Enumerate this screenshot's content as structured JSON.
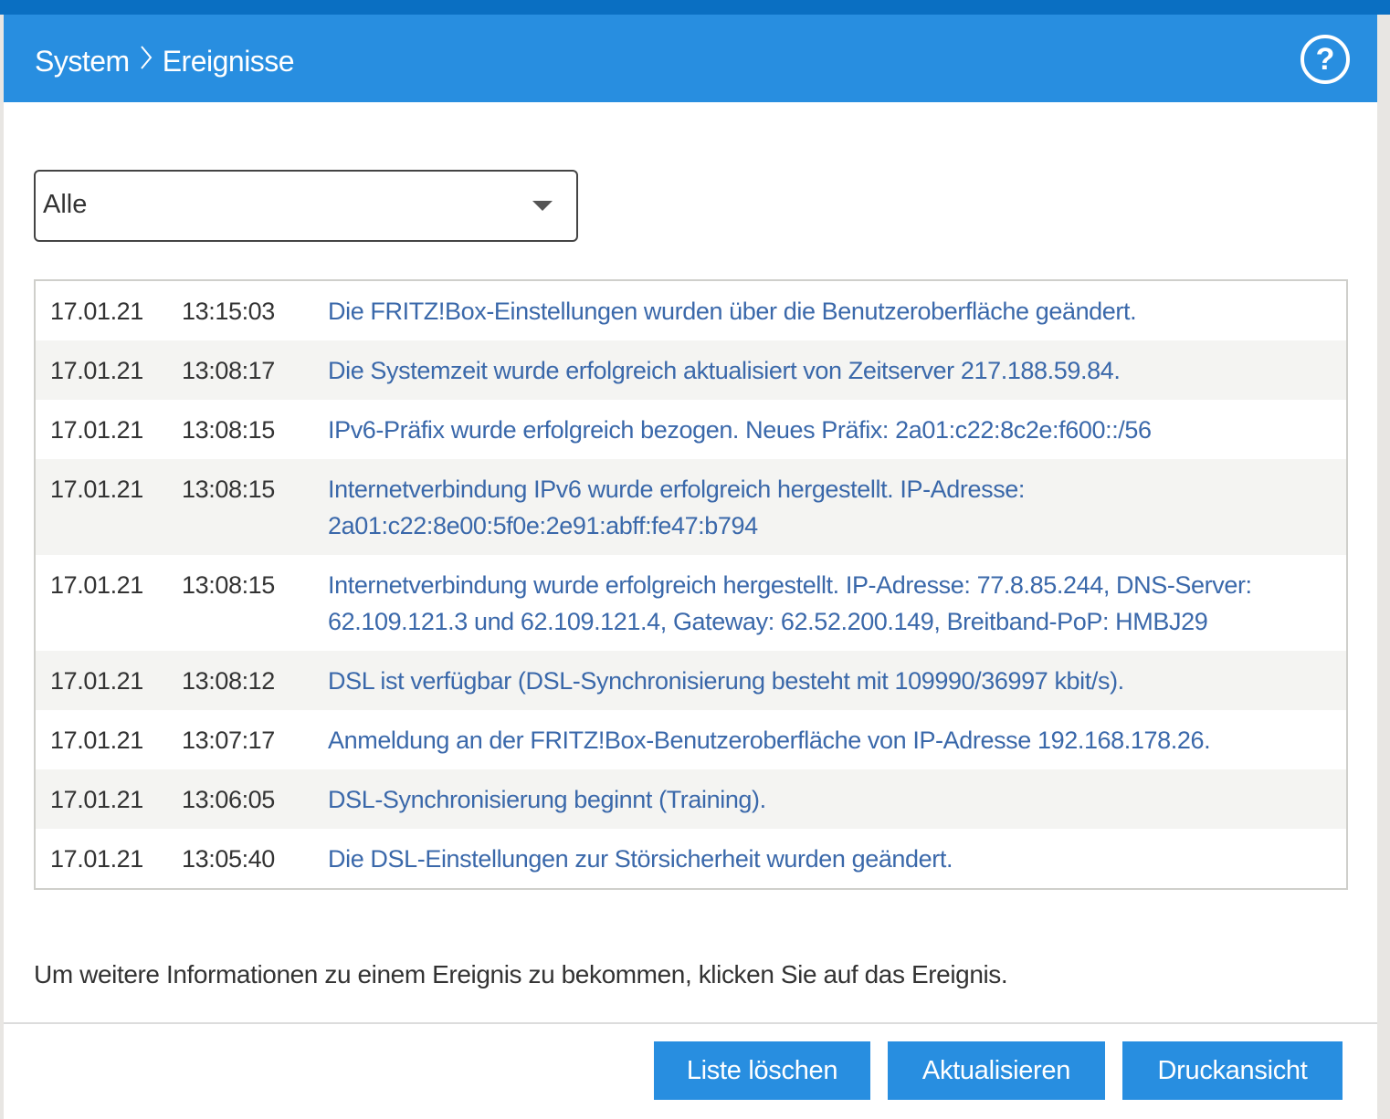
{
  "header": {
    "crumb_parent": "System",
    "crumb_separator": "›",
    "crumb_current": "Ereignisse",
    "help_label": "?"
  },
  "filter": {
    "selected": "Alle"
  },
  "events": [
    {
      "date": "17.01.21",
      "time": "13:15:03",
      "message": "Die FRITZ!Box-Einstellungen wurden über die Benutzeroberfläche geändert."
    },
    {
      "date": "17.01.21",
      "time": "13:08:17",
      "message": "Die Systemzeit wurde erfolgreich aktualisiert von Zeitserver 217.188.59.84."
    },
    {
      "date": "17.01.21",
      "time": "13:08:15",
      "message": "IPv6-Präfix wurde erfolgreich bezogen. Neues Präfix: 2a01:c22:8c2e:f600::/56"
    },
    {
      "date": "17.01.21",
      "time": "13:08:15",
      "message": "Internetverbindung IPv6 wurde erfolgreich hergestellt. IP-Adresse: 2a01:c22:8e00:5f0e:2e91:abff:fe47:b794"
    },
    {
      "date": "17.01.21",
      "time": "13:08:15",
      "message": "Internetverbindung wurde erfolgreich hergestellt. IP-Adresse: 77.8.85.244, DNS-Server: 62.109.121.3 und 62.109.121.4, Gateway: 62.52.200.149, Breitband-PoP: HMBJ29"
    },
    {
      "date": "17.01.21",
      "time": "13:08:12",
      "message": "DSL ist verfügbar (DSL-Synchronisierung besteht mit 109990/36997 kbit/s)."
    },
    {
      "date": "17.01.21",
      "time": "13:07:17",
      "message": "Anmeldung an der FRITZ!Box-Benutzeroberfläche von IP-Adresse 192.168.178.26."
    },
    {
      "date": "17.01.21",
      "time": "13:06:05",
      "message": "DSL-Synchronisierung beginnt (Training)."
    },
    {
      "date": "17.01.21",
      "time": "13:05:40",
      "message": "Die DSL-Einstellungen zur Störsicherheit wurden geändert."
    }
  ],
  "info_text": "Um weitere Informationen zu einem Ereignis zu bekommen, klicken Sie auf das Ereignis.",
  "buttons": {
    "clear": "Liste löschen",
    "refresh": "Aktualisieren",
    "print": "Druckansicht"
  }
}
